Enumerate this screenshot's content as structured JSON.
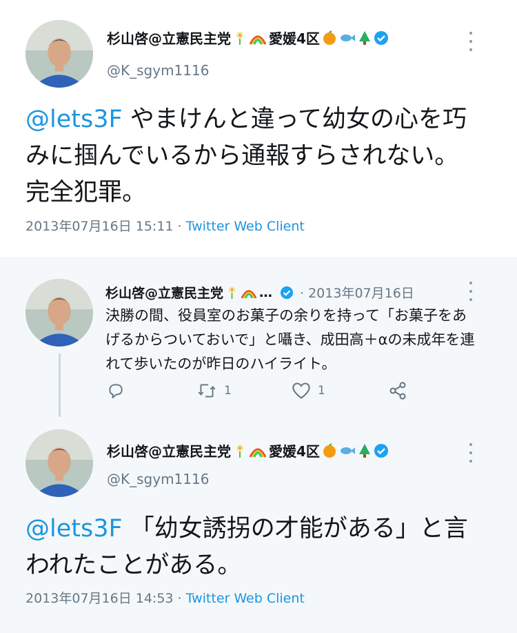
{
  "tweet1": {
    "author": "杉山啓@立憲民主党",
    "location_suffix": "愛媛4区",
    "handle": "@K_sgym1116",
    "mention": "@lets3F",
    "text": " やまけんと違って幼女の心を巧みに掴んでいるから通報すらされない。完全犯罪。",
    "date": "2013年07月16日 15:11",
    "separator": " · ",
    "source": "Twitter Web Client"
  },
  "reply": {
    "author": "杉山啓@立憲民主党",
    "ellipsis": "…",
    "date": "· 2013年07月16日",
    "text": "決勝の間、役員室のお菓子の余りを持って「お菓子をあげるからついておいで」と囁き、成田高＋αの未成年を連れて歩いたのが昨日のハイライト。",
    "retweets": "1",
    "likes": "1"
  },
  "tweet2": {
    "author": "杉山啓@立憲民主党",
    "location_suffix": "愛媛4区",
    "handle": "@K_sgym1116",
    "mention": "@lets3F",
    "text": " 「幼女誘拐の才能がある」と言われたことがある。",
    "date": "2013年07月16日 14:53",
    "separator": " · ",
    "source": "Twitter Web Client"
  },
  "colors": {
    "link": "#1b95e0",
    "muted": "#657786",
    "verified": "#1da1f2",
    "second_card_bg": "#f5f8fa"
  },
  "icons": [
    "flower-emoji-icon",
    "rainbow-emoji-icon",
    "orange-emoji-icon",
    "fish-emoji-icon",
    "tree-emoji-icon",
    "verified-badge-icon",
    "more-options-icon",
    "reply-icon",
    "retweet-icon",
    "like-icon",
    "share-icon"
  ]
}
